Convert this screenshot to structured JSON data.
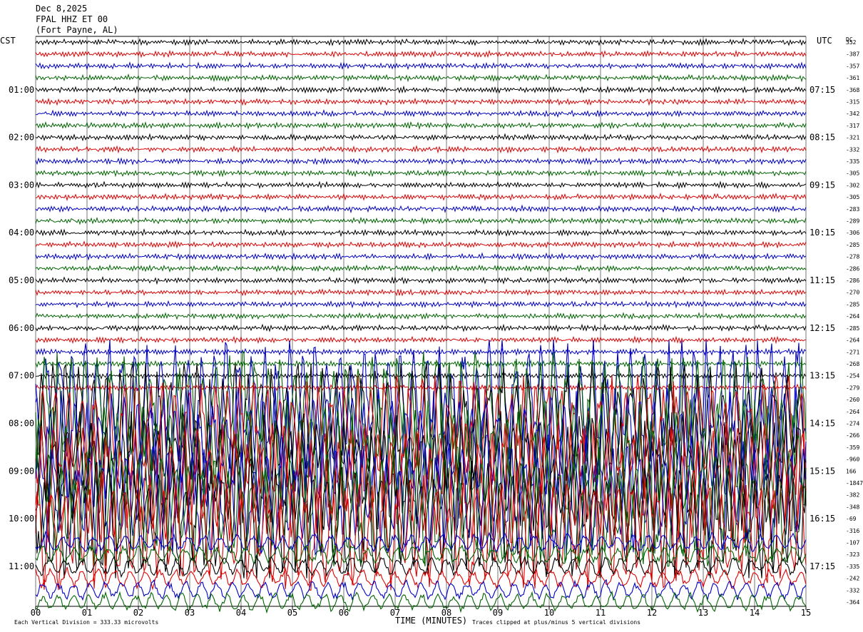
{
  "header": {
    "date": "Dec 8,2025",
    "station": "FPAL HHZ ET 00",
    "location": "(Fort Payne, AL)"
  },
  "left_zone_label": "CST",
  "right_zone_label": "UTC",
  "dc_label": "DC",
  "left_hours": [
    "01:00",
    "02:00",
    "03:00",
    "04:00",
    "05:00",
    "06:00",
    "07:00",
    "08:00",
    "09:00",
    "10:00",
    "11:00"
  ],
  "right_hours": [
    "07:15",
    "08:15",
    "09:15",
    "10:15",
    "11:15",
    "12:15",
    "13:15",
    "14:15",
    "15:15",
    "16:15",
    "17:15"
  ],
  "x_ticks": [
    "00",
    "01",
    "02",
    "03",
    "04",
    "05",
    "06",
    "07",
    "08",
    "09",
    "10",
    "11",
    "12",
    "13",
    "14",
    "15"
  ],
  "dc_offsets": [
    "352",
    "-387",
    "-357",
    "-361",
    "-368",
    "-315",
    "-342",
    "-317",
    "-321",
    "-332",
    "-335",
    "-305",
    "-302",
    "-305",
    "-283",
    "-289",
    "-306",
    "-285",
    "-278",
    "-286",
    "-286",
    "-270",
    "-285",
    "-264",
    "-285",
    "-264",
    "-271",
    "-268",
    "-254",
    "-279",
    "-260",
    "-264",
    "-274",
    "-266",
    "-359",
    "-960",
    "166",
    "-1847",
    "-382",
    "-348",
    "-69",
    "-316",
    "-107",
    "-323",
    "-335",
    "-242",
    "-332",
    "-364"
  ],
  "footer": {
    "division_note": "Each Vertical Division =  333.33 microvolts",
    "x_axis_label": "TIME (MINUTES)",
    "clip_note": "Traces clipped at plus/minus 5 vertical divisions"
  },
  "colors": {
    "trace_cycle": [
      "#000000",
      "#e00000",
      "#0000c8",
      "#006400"
    ],
    "gridline": "#000000"
  },
  "chart_data": {
    "type": "line",
    "title": "FPAL HHZ ET 00 (Fort Payne, AL) Dec 8,2025",
    "xlabel": "TIME (MINUTES)",
    "xlim": [
      0,
      15
    ],
    "lines_per_hour": 4,
    "minutes_per_line": 15,
    "line_count": 48,
    "first_line_start_cst": "00:00",
    "first_line_start_utc": "06:15",
    "quiet_lines": "1-30",
    "strong_signal_lines": "31-42 (clipped)",
    "moderate_signal_lines": "43-48",
    "clip_divisions": 5,
    "microvolts_per_division": 333.33
  }
}
